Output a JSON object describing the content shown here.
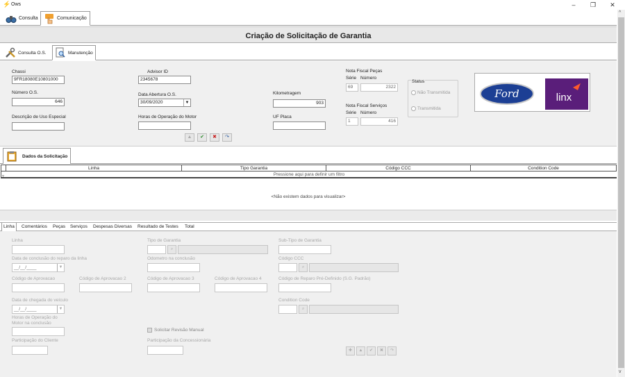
{
  "app": {
    "title": "Ows"
  },
  "top_tabs": [
    {
      "label": "Consulta"
    },
    {
      "label": "Comunicação"
    }
  ],
  "header": {
    "title": "Criação de Solicitação de Garantia"
  },
  "sub_tabs": [
    {
      "label": "Consulta O.S."
    },
    {
      "label": "Manutenção"
    }
  ],
  "form": {
    "chassi": {
      "label": "Chassi",
      "value": "9FR18080E10801000"
    },
    "numero_os": {
      "label": "Número O.S.",
      "value": "646"
    },
    "descricao": {
      "label": "Descrição de Uso Especial",
      "value": ""
    },
    "advisor": {
      "label": "Advisor ID",
      "value": "2345678"
    },
    "data_abertura": {
      "label": "Data Abertura O.S.",
      "value": "30/09/2020"
    },
    "horas_motor": {
      "label": "Horas de Operação do Motor",
      "value": ""
    },
    "kilometragem": {
      "label": "Kilometragem",
      "value": "903"
    },
    "uf_placa": {
      "label": "UF Placa",
      "value": ""
    },
    "nf_pecas": {
      "label": "Nota Fiscal Peças",
      "serie_label": "Série",
      "numero_label": "Número",
      "serie": "69",
      "numero": "2322"
    },
    "nf_servicos": {
      "label": "Nota Fiscal Serviços",
      "serie_label": "Série",
      "numero_label": "Número",
      "serie": "1",
      "numero": "416"
    },
    "status": {
      "legend": "Status",
      "opt1": "Não Transmitida",
      "opt2": "Transmitida"
    },
    "logos": {
      "ford": "Ford",
      "linx": "linx"
    }
  },
  "dados_tab": {
    "label": "Dados da Solicitação"
  },
  "grid": {
    "columns": [
      "Linha",
      "Tipo Garantia",
      "Código CCC",
      "Condition Code"
    ],
    "filter_text": "Pressione aqui para definir um filtro",
    "empty_text": "<Não existem dados para visualizar>"
  },
  "lower_tabs": [
    "Linha",
    "Comentários",
    "Peças",
    "Serviços",
    "Despesas Diversas",
    "Resultado de Testes",
    "Total"
  ],
  "lower": {
    "linha": "Linha",
    "tipo_garantia": "Tipo de Garantia",
    "subtipo": "Sub-Tipo de Garantia",
    "data_conclusao": "Data de conclusão do reparo da linha",
    "date_placeholder": "__/__/____",
    "odometro": "Odometro na conclusão",
    "codigo_ccc": "Código CCC",
    "cod_aprov": "Código de Aprovacao",
    "cod_aprov2": "Código de Aprovacao 2",
    "cod_aprov3": "Código de Aprovacao 3",
    "cod_aprov4": "Código de Aprovacao 4",
    "cod_reparo": "Código de Reparo Pré-Definido (S.G. Padrão)",
    "data_chegada": "Data de chegada do veículo",
    "condition_code": "Condition Code",
    "horas_op_1": "Horas de Operação do",
    "horas_op_2": "Motor na conclusão",
    "solicitar": "Solicitar Revisão Manual",
    "part_cliente": "Participação do Cliente",
    "part_conc": "Participação da Concessionária"
  }
}
